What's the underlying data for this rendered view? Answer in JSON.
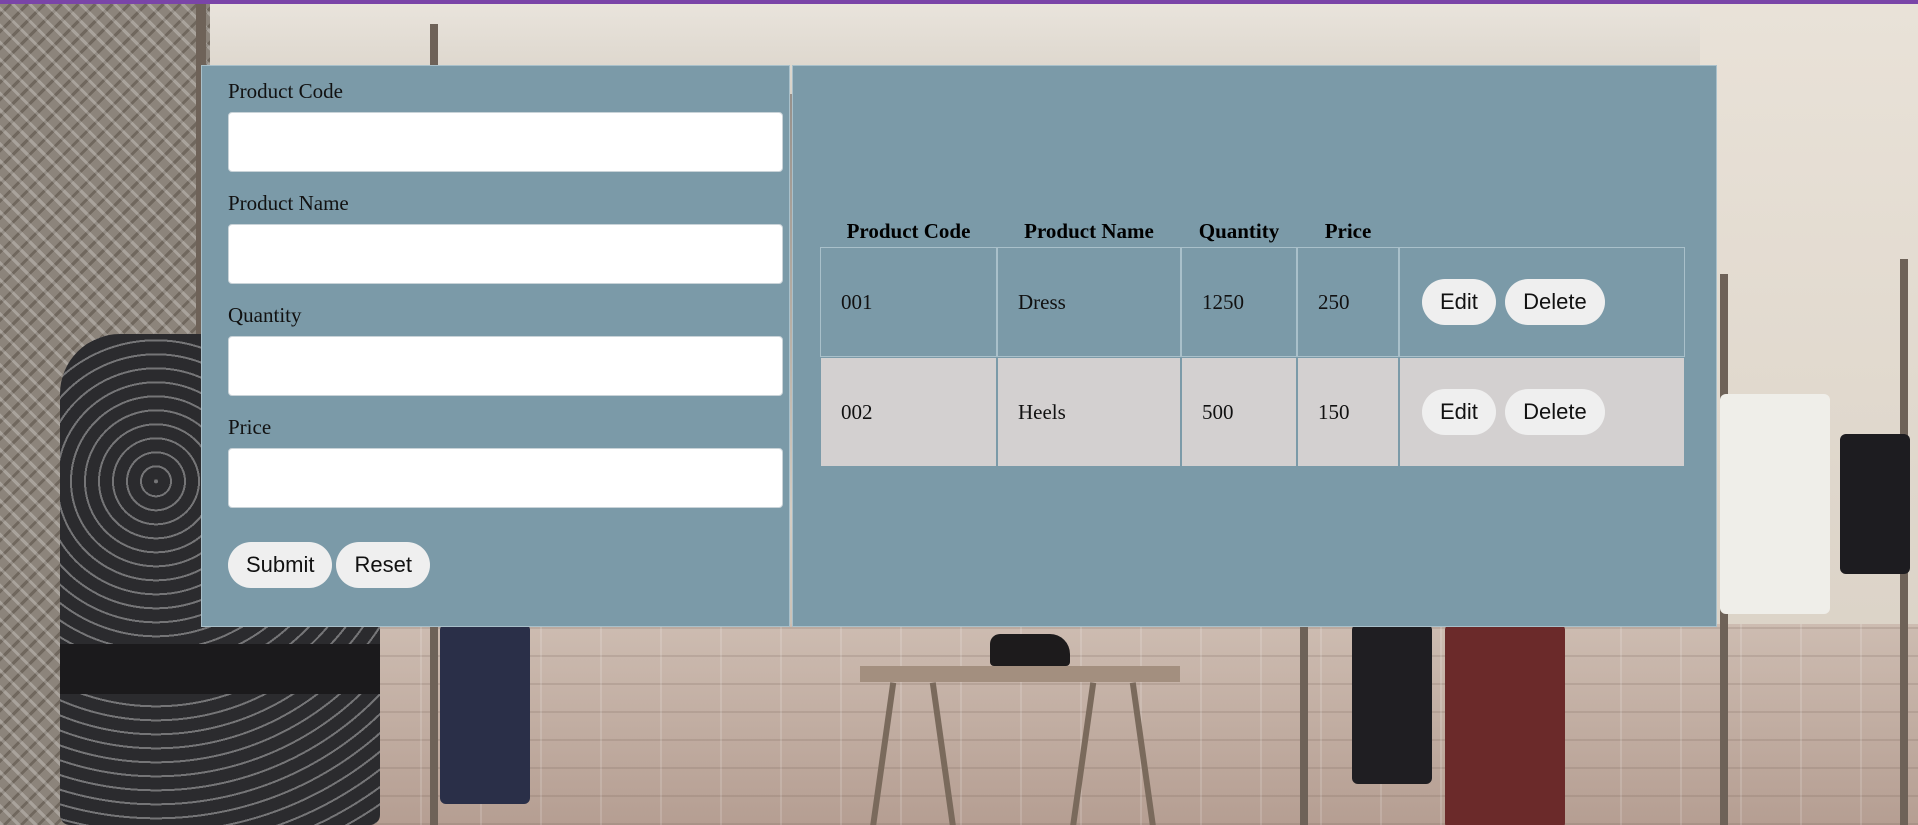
{
  "form": {
    "fields": [
      {
        "label": "Product Code",
        "value": ""
      },
      {
        "label": "Product Name",
        "value": ""
      },
      {
        "label": "Quantity",
        "value": ""
      },
      {
        "label": "Price",
        "value": ""
      }
    ],
    "submit_label": "Submit",
    "reset_label": "Reset"
  },
  "table": {
    "columns": [
      "Product Code",
      "Product Name",
      "Quantity",
      "Price"
    ],
    "rows": [
      {
        "code": "001",
        "name": "Dress",
        "quantity": "1250",
        "price": "250",
        "edit_label": "Edit",
        "delete_label": "Delete"
      },
      {
        "code": "002",
        "name": "Heels",
        "quantity": "500",
        "price": "150",
        "edit_label": "Edit",
        "delete_label": "Delete"
      }
    ]
  },
  "colors": {
    "panel": "#7b9aa8",
    "row_alt": "#d3d0d0",
    "button": "#efefef",
    "top_bar": "#7a45a8"
  }
}
